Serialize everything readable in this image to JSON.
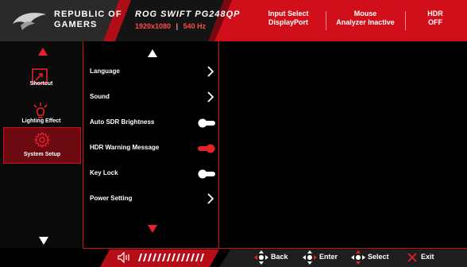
{
  "header": {
    "brand_line1": "REPUBLIC OF",
    "brand_line2": "GAMERS",
    "model": "ROG SWIFT PG248QP",
    "resolution": "1920x1080",
    "refresh": "540 Hz",
    "status": [
      {
        "title": "Input Select",
        "value": "DisplayPort"
      },
      {
        "title": "Mouse",
        "value": "Analyzer Inactive"
      },
      {
        "title": "HDR",
        "value": "OFF"
      }
    ]
  },
  "sidebar": {
    "items": [
      {
        "label": "Shortcut",
        "icon": "shortcut-icon"
      },
      {
        "label": "Lighting Effect",
        "icon": "lighting-icon"
      },
      {
        "label": "System Setup",
        "icon": "gear-icon",
        "selected": true
      }
    ]
  },
  "menu": {
    "items": [
      {
        "label": "Language",
        "control": "arrow"
      },
      {
        "label": "Sound",
        "control": "arrow"
      },
      {
        "label": "Auto SDR Brightness",
        "control": "toggle",
        "on": false
      },
      {
        "label": "HDR Warning Message",
        "control": "toggle",
        "on": true
      },
      {
        "label": "Key Lock",
        "control": "toggle",
        "on": false
      },
      {
        "label": "Power Setting",
        "control": "arrow"
      }
    ]
  },
  "footer": {
    "keys": [
      {
        "label": "Back"
      },
      {
        "label": "Enter"
      },
      {
        "label": "Select"
      },
      {
        "label": "Exit"
      }
    ]
  },
  "colors": {
    "accent": "#d00f1b",
    "toggle_on": "#e8202a",
    "toggle_off": "#ffffff"
  }
}
